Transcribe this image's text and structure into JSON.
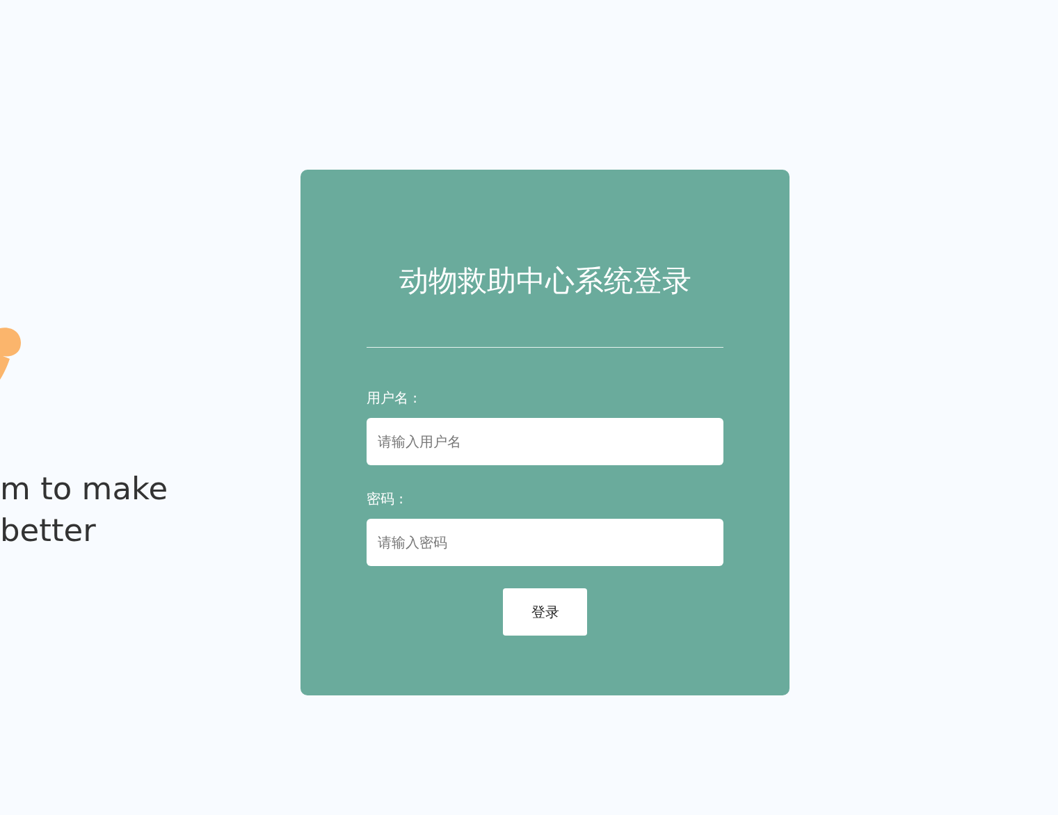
{
  "background": {
    "slogan_lines": [
      "m to make",
      "better"
    ]
  },
  "login": {
    "title": "动物救助中心系统登录",
    "fields": [
      {
        "label": "用户名 :",
        "placeholder": "请输入用户名"
      },
      {
        "label": "密码 :",
        "placeholder": "请输入密码"
      }
    ],
    "button": "登录"
  }
}
